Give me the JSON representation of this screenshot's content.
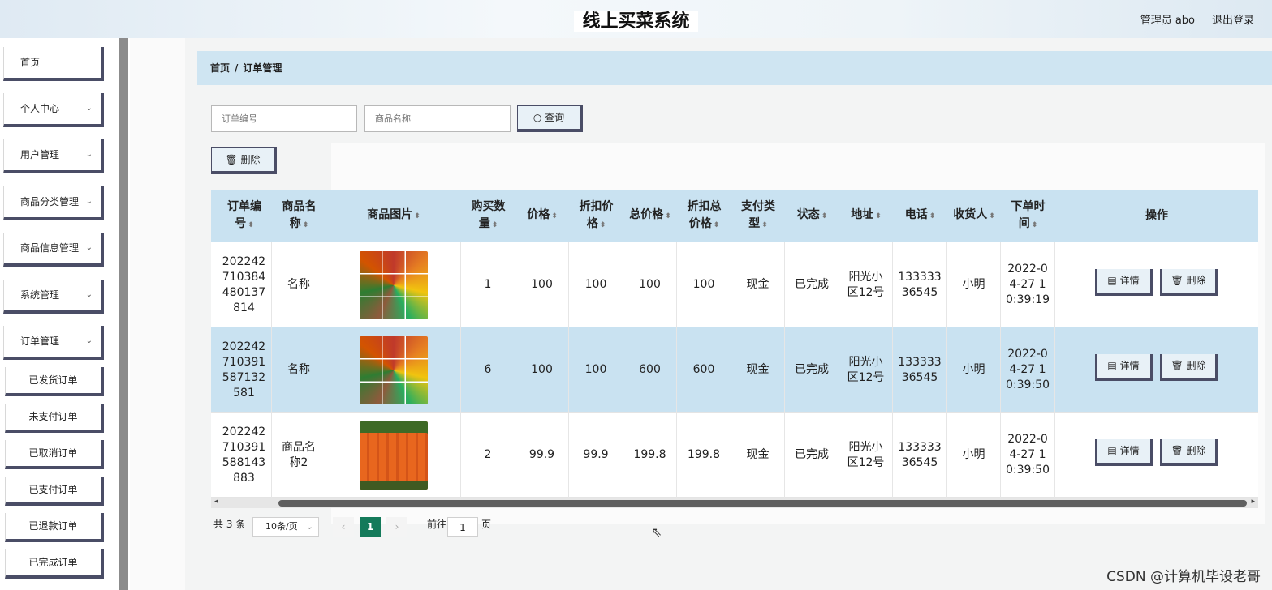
{
  "header": {
    "title": "线上买菜系统",
    "admin_label": "管理员 abo",
    "logout_label": "退出登录"
  },
  "sidebar": {
    "menu": [
      {
        "label": "首页",
        "chevron": ""
      },
      {
        "label": "个人中心",
        "chevron": "⌄"
      },
      {
        "label": "用户管理",
        "chevron": "⌄"
      },
      {
        "label": "商品分类管理",
        "chevron": "⌄"
      },
      {
        "label": "商品信息管理",
        "chevron": "⌄"
      },
      {
        "label": "系统管理",
        "chevron": "⌄"
      },
      {
        "label": "订单管理",
        "chevron": "⌄"
      }
    ],
    "submenu": [
      "已发货订单",
      "未支付订单",
      "已取消订单",
      "已支付订单",
      "已退款订单",
      "已完成订单"
    ]
  },
  "breadcrumb": {
    "home": "首页",
    "separator": "/",
    "current": "订单管理"
  },
  "search": {
    "order_no_placeholder": "订单编号",
    "product_name_placeholder": "商品名称",
    "query_label": "查询",
    "delete_label": "删除"
  },
  "table": {
    "headers": {
      "order_no_1": "订单编",
      "order_no_2": "号",
      "product_1": "商品名",
      "product_2": "称",
      "image": "商品图片",
      "qty_1": "购买数",
      "qty_2": "量",
      "price": "价格",
      "discount_1": "折扣价",
      "discount_2": "格",
      "total": "总价格",
      "dtotal_1": "折扣总",
      "dtotal_2": "价格",
      "pay_1": "支付类",
      "pay_2": "型",
      "status": "状态",
      "address": "地址",
      "phone": "电话",
      "receiver": "收货人",
      "time_1": "下单时",
      "time_2": "间",
      "ops": "操作",
      "sort_icon": "⬍"
    },
    "rows": [
      {
        "order_no": [
          "202242",
          "710384",
          "480137",
          "814"
        ],
        "product": [
          "名称"
        ],
        "image": "veg",
        "qty": "1",
        "price": "100",
        "discount": "100",
        "total": "100",
        "dtotal": "100",
        "pay": "现金",
        "status": "已完成",
        "address": [
          "阳光小",
          "区12号"
        ],
        "phone": [
          "133333",
          "36545"
        ],
        "receiver": "小明",
        "time": [
          "2022-0",
          "4-27 1",
          "0:39:19"
        ],
        "detail_label": "详情",
        "delete_label": "删除"
      },
      {
        "order_no": [
          "202242",
          "710391",
          "587132",
          "581"
        ],
        "product": [
          "名称"
        ],
        "image": "veg",
        "qty": "6",
        "price": "100",
        "discount": "100",
        "total": "600",
        "dtotal": "600",
        "pay": "现金",
        "status": "已完成",
        "address": [
          "阳光小",
          "区12号"
        ],
        "phone": [
          "133333",
          "36545"
        ],
        "receiver": "小明",
        "time": [
          "2022-0",
          "4-27 1",
          "0:39:50"
        ],
        "detail_label": "详情",
        "delete_label": "删除"
      },
      {
        "order_no": [
          "202242",
          "710391",
          "588143",
          "883"
        ],
        "product": [
          "商品名",
          "称2"
        ],
        "image": "carrot",
        "qty": "2",
        "price": "99.9",
        "discount": "99.9",
        "total": "199.8",
        "dtotal": "199.8",
        "pay": "现金",
        "status": "已完成",
        "address": [
          "阳光小",
          "区12号"
        ],
        "phone": [
          "133333",
          "36545"
        ],
        "receiver": "小明",
        "time": [
          "2022-0",
          "4-27 1",
          "0:39:50"
        ],
        "detail_label": "详情",
        "delete_label": "删除"
      }
    ]
  },
  "pagination": {
    "total_text": "共 3 条",
    "page_size": "10条/页",
    "current_page": "1",
    "goto_label": "前往",
    "goto_value": "1",
    "page_unit": "页",
    "prev_icon": "‹",
    "next_icon": "›"
  },
  "watermark": "CSDN @计算机毕设老哥"
}
